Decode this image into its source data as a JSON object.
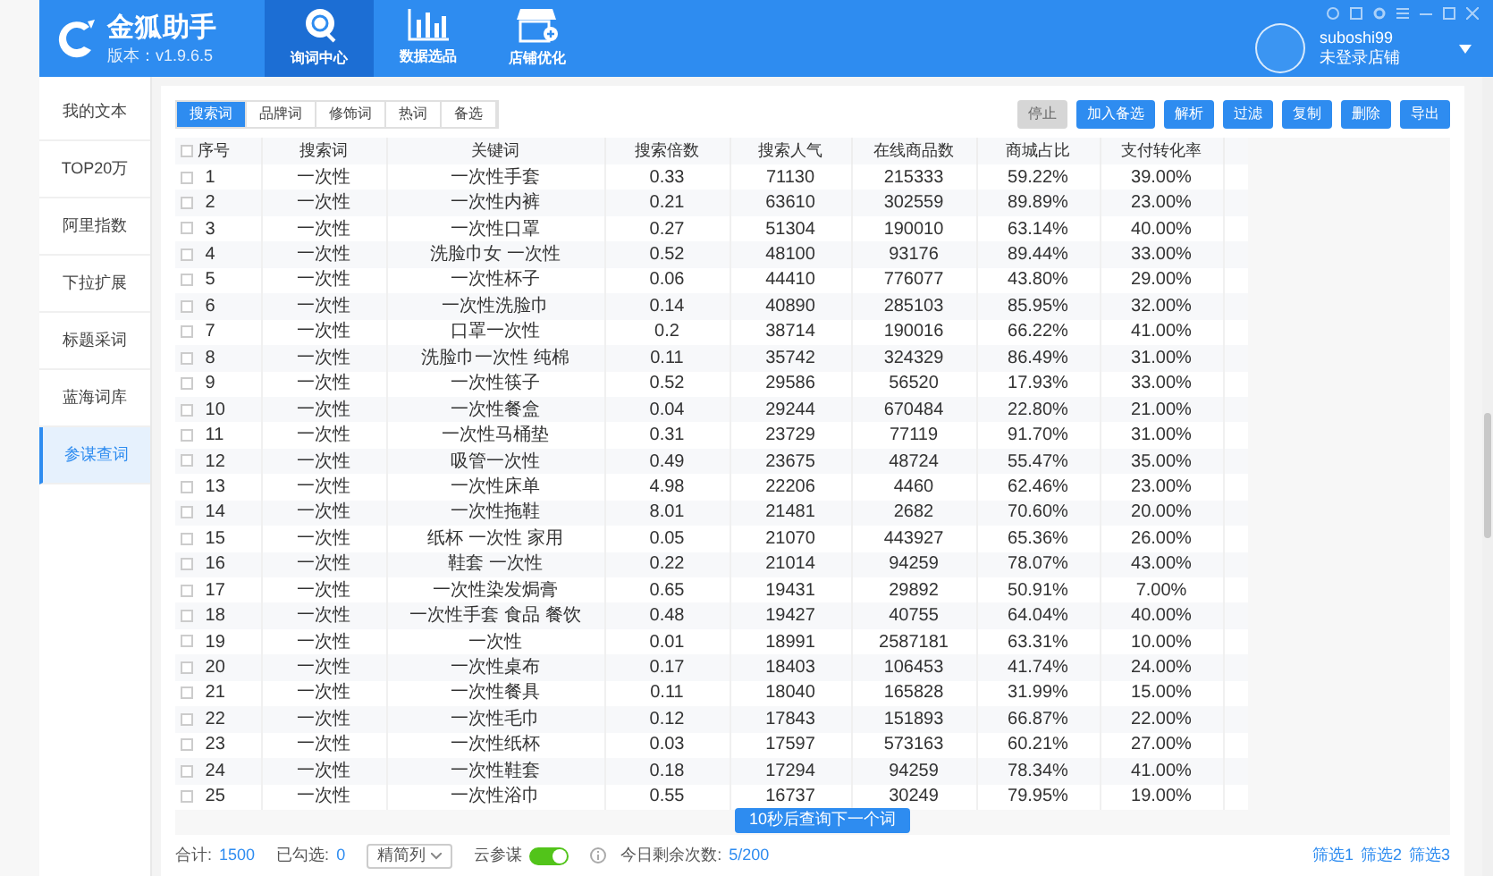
{
  "app": {
    "logo_text": "金狐助手",
    "version": "版本：v1.9.6.5"
  },
  "nav_tabs": [
    {
      "label": "询词中心",
      "kind": "query",
      "selected": true
    },
    {
      "label": "数据选品",
      "kind": "chart",
      "selected": false
    },
    {
      "label": "店铺优化",
      "kind": "shop",
      "selected": false
    }
  ],
  "user": {
    "name": "suboshi99",
    "store": "未登录店铺"
  },
  "sidebar": {
    "items": [
      {
        "label": "我的文本",
        "selected": false
      },
      {
        "label": "TOP20万",
        "selected": false
      },
      {
        "label": "阿里指数",
        "selected": false
      },
      {
        "label": "下拉扩展",
        "selected": false
      },
      {
        "label": "标题采词",
        "selected": false
      },
      {
        "label": "蓝海词库",
        "selected": false
      },
      {
        "label": "参谋查词",
        "selected": true
      }
    ]
  },
  "word_tabs": [
    {
      "label": "搜索词",
      "selected": true
    },
    {
      "label": "品牌词",
      "selected": false
    },
    {
      "label": "修饰词",
      "selected": false
    },
    {
      "label": "热词",
      "selected": false
    },
    {
      "label": "备选",
      "selected": false
    }
  ],
  "actions": [
    {
      "label": "停止",
      "kind": "secondary"
    },
    {
      "label": "加入备选",
      "kind": "primary"
    },
    {
      "label": "解析",
      "kind": "primary"
    },
    {
      "label": "过滤",
      "kind": "primary"
    },
    {
      "label": "复制",
      "kind": "primary"
    },
    {
      "label": "删除",
      "kind": "primary"
    },
    {
      "label": "导出",
      "kind": "primary"
    }
  ],
  "table": {
    "select_all_checked": false,
    "columns": [
      "序号",
      "搜索词",
      "关键词",
      "搜索倍数",
      "搜索人气",
      "在线商品数",
      "商城占比",
      "支付转化率"
    ],
    "rows": [
      {
        "checked": false,
        "cells": [
          "1",
          "一次性",
          "一次性手套",
          "0.33",
          "71130",
          "215333",
          "59.22%",
          "39.00%"
        ]
      },
      {
        "checked": false,
        "cells": [
          "2",
          "一次性",
          "一次性内裤",
          "0.21",
          "63610",
          "302559",
          "89.89%",
          "23.00%"
        ]
      },
      {
        "checked": false,
        "cells": [
          "3",
          "一次性",
          "一次性口罩",
          "0.27",
          "51304",
          "190010",
          "63.14%",
          "40.00%"
        ]
      },
      {
        "checked": false,
        "cells": [
          "4",
          "一次性",
          "洗脸巾女 一次性",
          "0.52",
          "48100",
          "93176",
          "89.44%",
          "33.00%"
        ]
      },
      {
        "checked": false,
        "cells": [
          "5",
          "一次性",
          "一次性杯子",
          "0.06",
          "44410",
          "776077",
          "43.80%",
          "29.00%"
        ]
      },
      {
        "checked": false,
        "cells": [
          "6",
          "一次性",
          "一次性洗脸巾",
          "0.14",
          "40890",
          "285103",
          "85.95%",
          "32.00%"
        ]
      },
      {
        "checked": false,
        "cells": [
          "7",
          "一次性",
          "口罩一次性",
          "0.2",
          "38714",
          "190016",
          "66.22%",
          "41.00%"
        ]
      },
      {
        "checked": false,
        "cells": [
          "8",
          "一次性",
          "洗脸巾一次性 纯棉",
          "0.11",
          "35742",
          "324329",
          "86.49%",
          "31.00%"
        ]
      },
      {
        "checked": false,
        "cells": [
          "9",
          "一次性",
          "一次性筷子",
          "0.52",
          "29586",
          "56520",
          "17.93%",
          "33.00%"
        ]
      },
      {
        "checked": false,
        "cells": [
          "10",
          "一次性",
          "一次性餐盒",
          "0.04",
          "29244",
          "670484",
          "22.80%",
          "21.00%"
        ]
      },
      {
        "checked": false,
        "cells": [
          "11",
          "一次性",
          "一次性马桶垫",
          "0.31",
          "23729",
          "77119",
          "91.70%",
          "31.00%"
        ]
      },
      {
        "checked": false,
        "cells": [
          "12",
          "一次性",
          "吸管一次性",
          "0.49",
          "23675",
          "48724",
          "55.47%",
          "35.00%"
        ]
      },
      {
        "checked": false,
        "cells": [
          "13",
          "一次性",
          "一次性床单",
          "4.98",
          "22206",
          "4460",
          "62.46%",
          "23.00%"
        ]
      },
      {
        "checked": false,
        "cells": [
          "14",
          "一次性",
          "一次性拖鞋",
          "8.01",
          "21481",
          "2682",
          "70.60%",
          "20.00%"
        ]
      },
      {
        "checked": false,
        "cells": [
          "15",
          "一次性",
          "纸杯 一次性 家用",
          "0.05",
          "21070",
          "443927",
          "65.36%",
          "26.00%"
        ]
      },
      {
        "checked": false,
        "cells": [
          "16",
          "一次性",
          "鞋套 一次性",
          "0.22",
          "21014",
          "94259",
          "78.07%",
          "43.00%"
        ]
      },
      {
        "checked": false,
        "cells": [
          "17",
          "一次性",
          "一次性染发焗膏",
          "0.65",
          "19431",
          "29892",
          "50.91%",
          "7.00%"
        ]
      },
      {
        "checked": false,
        "cells": [
          "18",
          "一次性",
          "一次性手套 食品 餐饮",
          "0.48",
          "19427",
          "40755",
          "64.04%",
          "40.00%"
        ]
      },
      {
        "checked": false,
        "cells": [
          "19",
          "一次性",
          "一次性",
          "0.01",
          "18991",
          "2587181",
          "63.31%",
          "10.00%"
        ]
      },
      {
        "checked": false,
        "cells": [
          "20",
          "一次性",
          "一次性桌布",
          "0.17",
          "18403",
          "106453",
          "41.74%",
          "24.00%"
        ]
      },
      {
        "checked": false,
        "cells": [
          "21",
          "一次性",
          "一次性餐具",
          "0.11",
          "18040",
          "165828",
          "31.99%",
          "15.00%"
        ]
      },
      {
        "checked": false,
        "cells": [
          "22",
          "一次性",
          "一次性毛巾",
          "0.12",
          "17843",
          "151893",
          "66.87%",
          "22.00%"
        ]
      },
      {
        "checked": false,
        "cells": [
          "23",
          "一次性",
          "一次性纸杯",
          "0.03",
          "17597",
          "573163",
          "60.21%",
          "27.00%"
        ]
      },
      {
        "checked": false,
        "cells": [
          "24",
          "一次性",
          "一次性鞋套",
          "0.18",
          "17294",
          "94259",
          "78.34%",
          "41.00%"
        ]
      },
      {
        "checked": false,
        "cells": [
          "25",
          "一次性",
          "一次性浴巾",
          "0.55",
          "16737",
          "30249",
          "79.95%",
          "19.00%"
        ]
      }
    ]
  },
  "toast": "10秒后查询下一个词",
  "footer": {
    "total_label": "合计:",
    "total": "1500",
    "checked_label": "已勾选:",
    "checked": "0",
    "column_mode": "精简列",
    "cloud_label": "云参谋",
    "cloud_on": true,
    "remaining_label": "今日剩余次数:",
    "remaining": "5/200",
    "filters": [
      "筛选1",
      "筛选2",
      "筛选3"
    ]
  }
}
